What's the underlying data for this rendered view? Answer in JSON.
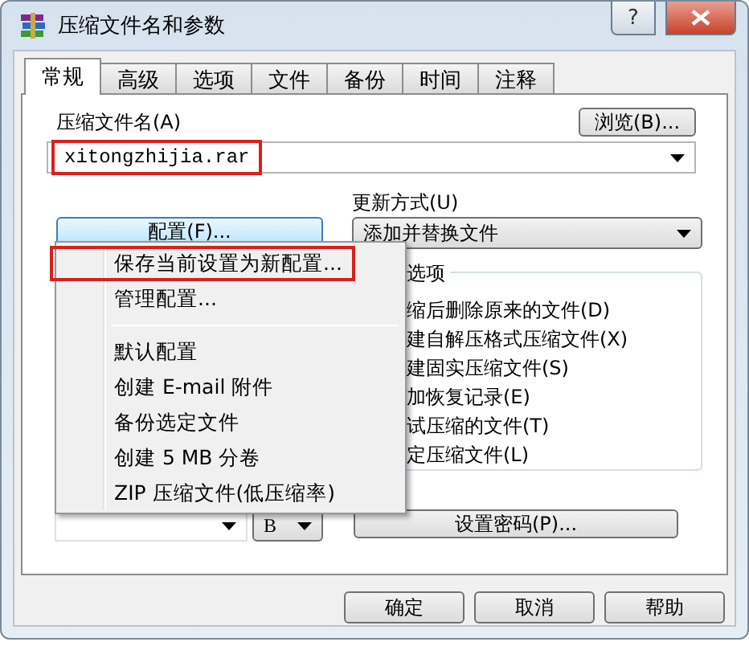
{
  "window": {
    "title": "压缩文件名和参数",
    "help_button": "?"
  },
  "tabs": [
    {
      "label": "常规",
      "selected": true
    },
    {
      "label": "高级",
      "selected": false
    },
    {
      "label": "选项",
      "selected": false
    },
    {
      "label": "文件",
      "selected": false
    },
    {
      "label": "备份",
      "selected": false
    },
    {
      "label": "时间",
      "selected": false
    },
    {
      "label": "注释",
      "selected": false
    }
  ],
  "archive_name": {
    "label": "压缩文件名(A)",
    "value": "xitongzhijia.rar",
    "highlighted": true
  },
  "browse_button": "浏览(B)...",
  "update_mode": {
    "label": "更新方式(U)",
    "value": "添加并替换文件"
  },
  "profiles_button": "配置(F)...",
  "profiles_menu": [
    {
      "kind": "item",
      "label": "保存当前设置为新配置...",
      "highlighted": true
    },
    {
      "kind": "item",
      "label": "管理配置...",
      "highlighted": false
    },
    {
      "kind": "separator"
    },
    {
      "kind": "item",
      "label": "默认配置",
      "highlighted": false
    },
    {
      "kind": "item",
      "label": "创建 E-mail 附件",
      "highlighted": false
    },
    {
      "kind": "item",
      "label": "备份选定文件",
      "highlighted": false
    },
    {
      "kind": "item",
      "label": "创建 5 MB 分卷",
      "highlighted": false
    },
    {
      "kind": "item",
      "label": "ZIP 压缩文件(低压缩率)",
      "highlighted": false
    }
  ],
  "options_group": {
    "label": "选项",
    "items": [
      "缩后删除原来的文件(D)",
      "建自解压格式压缩文件(X)",
      "建固实压缩文件(S)",
      "加恢复记录(E)",
      "试压缩的文件(T)",
      "定压缩文件(L)"
    ]
  },
  "split_unit": "B",
  "password_button": "设置密码(P)...",
  "buttons": [
    "确定",
    "取消",
    "帮助"
  ]
}
